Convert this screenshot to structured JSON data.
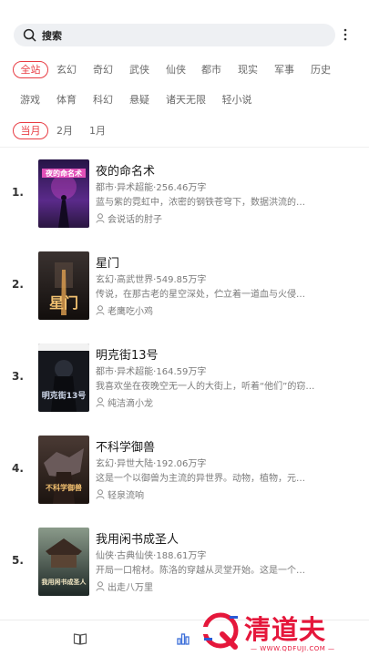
{
  "search": {
    "placeholder": "搜索"
  },
  "filters": {
    "categories": [
      "全站",
      "玄幻",
      "奇幻",
      "武侠",
      "仙侠",
      "都市",
      "现实",
      "军事",
      "历史",
      "游戏",
      "体育",
      "科幻",
      "悬疑",
      "诸天无限",
      "轻小说"
    ],
    "categories_selected": "全站",
    "periods": [
      "当月",
      "2月",
      "1月"
    ],
    "periods_selected": "当月"
  },
  "books": [
    {
      "rank": "1.",
      "title": "夜的命名术",
      "meta": "都市·异术超能·256.46万字",
      "desc": "蓝与紫的霓虹中，浓密的钢铁苍穹下，数据洪流的…",
      "author": "会说话的肘子"
    },
    {
      "rank": "2.",
      "title": "星门",
      "meta": "玄幻·高武世界·549.85万字",
      "desc": "传说，在那古老的星空深处，伫立着一道血与火侵…",
      "author": "老鹰吃小鸡"
    },
    {
      "rank": "3.",
      "title": "明克街13号",
      "meta": "都市·异术超能·164.59万字",
      "desc": "我喜欢坐在夜晚空无一人的大街上，听着“他们”的窃…",
      "author": "纯洁滴小龙"
    },
    {
      "rank": "4.",
      "title": "不科学御兽",
      "meta": "玄幻·异世大陆·192.06万字",
      "desc": "这是一个以御兽为主流的异世界。动物，植物，元…",
      "author": "轻泉流响"
    },
    {
      "rank": "5.",
      "title": "我用闲书成圣人",
      "meta": "仙侠·古典仙侠·188.61万字",
      "desc": "开局一口棺材。陈洛的穿越从灵堂开始。这是一个…",
      "author": "出走八万里"
    }
  ],
  "covers": [
    {
      "text": "夜的命名术",
      "bg": "#3a1f5c",
      "accent": "#e64ad6"
    },
    {
      "text": "星门",
      "bg": "#1e1a18",
      "accent": "#e0a050"
    },
    {
      "text": "明克街13号",
      "bg": "#14161c",
      "accent": "#5a6c8a"
    },
    {
      "text": "不科学御兽",
      "bg": "#3a2620",
      "accent": "#d8a05a"
    },
    {
      "text": "我用闲书成圣人",
      "bg": "#2b3a38",
      "accent": "#c9b27a"
    }
  ],
  "watermark": {
    "text": "清道夫",
    "url": "— WWW.QDFUJI.COM —"
  },
  "colors": {
    "accent": "#e83c43",
    "watermark": "#e5173b"
  }
}
